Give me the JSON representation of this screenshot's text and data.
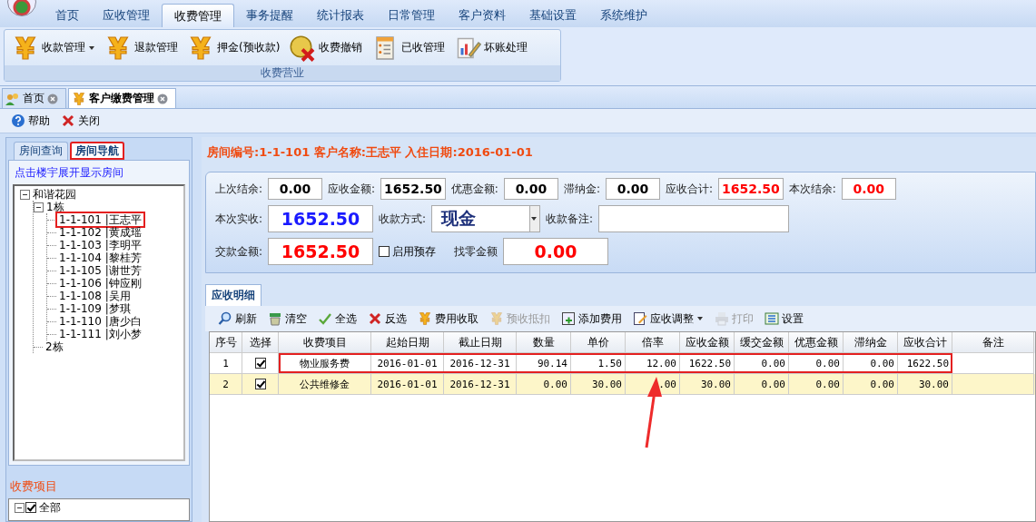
{
  "menu_tabs": [
    {
      "label": "首页",
      "selected": false
    },
    {
      "label": "应收管理",
      "selected": false
    },
    {
      "label": "收费管理",
      "selected": true
    },
    {
      "label": "事务提醒",
      "selected": false
    },
    {
      "label": "统计报表",
      "selected": false
    },
    {
      "label": "日常管理",
      "selected": false
    },
    {
      "label": "客户资料",
      "selected": false
    },
    {
      "label": "基础设置",
      "selected": false
    },
    {
      "label": "系统维护",
      "selected": false
    }
  ],
  "ribbon": {
    "group_label": "收费营业",
    "buttons": [
      {
        "label": "收款管理",
        "kind": "yen",
        "dropdown": true
      },
      {
        "label": "退款管理",
        "kind": "yen",
        "dropdown": false
      },
      {
        "label": "押金(预收款)",
        "kind": "yen",
        "dropdown": false
      },
      {
        "label": "收费撤销",
        "kind": "coin-cancel",
        "dropdown": false
      },
      {
        "label": "已收管理",
        "kind": "document",
        "dropdown": false
      },
      {
        "label": "坏账处理",
        "kind": "chart-pencil",
        "dropdown": false
      }
    ]
  },
  "doc_tabs": [
    {
      "label": "首页",
      "selected": false,
      "kind": "people"
    },
    {
      "label": "客户缴费管理",
      "selected": true,
      "kind": "yen"
    }
  ],
  "toolbar": [
    {
      "label": "帮助",
      "kind": "help"
    },
    {
      "label": "关闭",
      "kind": "close"
    }
  ],
  "left_panel": {
    "tabs": [
      {
        "label": "房间查询",
        "selected": false,
        "highlighted": false
      },
      {
        "label": "房间导航",
        "selected": true,
        "highlighted": true
      }
    ],
    "hint": "点击楼宇展开显示房间",
    "tree": [
      {
        "label": "和谐花园",
        "expanded": true,
        "children": [
          {
            "label": "1栋",
            "expanded": true,
            "children": [
              {
                "label": "1-1-101 |王志平",
                "highlighted": true
              },
              {
                "label": "1-1-102 |黄成瑶",
                "highlighted": false
              },
              {
                "label": "1-1-103 |李明平",
                "highlighted": false
              },
              {
                "label": "1-1-104 |黎桂芳",
                "highlighted": false
              },
              {
                "label": "1-1-105 |谢世芳",
                "highlighted": false
              },
              {
                "label": "1-1-106 |钟应刚",
                "highlighted": false
              },
              {
                "label": "1-1-108 |吴用",
                "highlighted": false
              },
              {
                "label": "1-1-109 |梦琪",
                "highlighted": false
              },
              {
                "label": "1-1-110 |唐少白",
                "highlighted": false
              },
              {
                "label": "1-1-111 |刘小梦",
                "highlighted": false
              }
            ]
          },
          {
            "label": "2栋",
            "highlighted": false
          }
        ]
      }
    ],
    "fee_label": "收费项目",
    "fee_tree": [
      {
        "label": "全部",
        "expanded": true,
        "checked": true
      }
    ]
  },
  "info_title": "房间编号:1-1-101 客户名称:王志平 入住日期:2016-01-01",
  "form_rows": [
    [
      {
        "kind": "field",
        "label": "上次结余:",
        "value": "0.00"
      },
      {
        "kind": "field",
        "label": "应收金额:",
        "value": "1652.50"
      },
      {
        "kind": "field",
        "label": "优惠金额:",
        "value": "0.00"
      },
      {
        "kind": "field",
        "label": "滞纳金:",
        "value": "0.00"
      },
      {
        "kind": "field",
        "label": "应收合计:",
        "value": "1652.50"
      },
      {
        "kind": "field",
        "label": "本次结余:",
        "value": "0.00"
      }
    ],
    [
      {
        "kind": "field",
        "label": "本次实收:",
        "value": "1652.50"
      },
      {
        "kind": "select",
        "label": "收款方式:",
        "value": "现金"
      },
      {
        "kind": "field",
        "label": "收款备注:"
      }
    ],
    [
      {
        "kind": "field",
        "label": "交款金额:",
        "value": "1652.50"
      },
      {
        "kind": "checkbox",
        "label": "启用预存",
        "checked": false
      },
      {
        "kind": "field",
        "label": "找零金额",
        "value": "0.00"
      }
    ]
  ],
  "detail": {
    "tab": "应收明细",
    "toolbar": [
      {
        "label": "刷新",
        "kind": "search",
        "disabled": false,
        "dropdown": false
      },
      {
        "label": "清空",
        "kind": "broom",
        "disabled": false,
        "dropdown": false
      },
      {
        "label": "全选",
        "kind": "check",
        "disabled": false,
        "dropdown": false
      },
      {
        "label": "反选",
        "kind": "cross",
        "disabled": false,
        "dropdown": false
      },
      {
        "label": "费用收取",
        "kind": "yen",
        "disabled": false,
        "dropdown": false
      },
      {
        "label": "预收抵扣",
        "kind": "yen",
        "disabled": true,
        "dropdown": false
      },
      {
        "label": "添加费用",
        "kind": "add",
        "disabled": false,
        "dropdown": false
      },
      {
        "label": "应收调整",
        "kind": "edit",
        "disabled": false,
        "dropdown": true
      },
      {
        "label": "打印",
        "kind": "printer",
        "disabled": true,
        "dropdown": false
      },
      {
        "label": "设置",
        "kind": "settings",
        "disabled": false,
        "dropdown": false
      }
    ],
    "columns": [
      "序号",
      "选择",
      "收费项目",
      "起始日期",
      "截止日期",
      "数量",
      "单价",
      "倍率",
      "应收金额",
      "缓交金额",
      "优惠金额",
      "滞纳金",
      "应收合计",
      "备注"
    ],
    "rows": [
      {
        "selected": false,
        "highlighted": true,
        "cells": [
          "1",
          {
            "checked": true
          },
          "物业服务费",
          "2016-01-01",
          "2016-12-31",
          "90.14",
          "1.50",
          "12.00",
          "1622.50",
          "0.00",
          "0.00",
          "0.00",
          "1622.50"
        ]
      },
      {
        "selected": true,
        "highlighted": false,
        "cells": [
          "2",
          {
            "checked": true
          },
          "公共维修金",
          "2016-01-01",
          "2016-12-31",
          "0.00",
          "30.00",
          ".00",
          "30.00",
          "0.00",
          "0.00",
          "0.00",
          "30.00"
        ]
      }
    ]
  }
}
